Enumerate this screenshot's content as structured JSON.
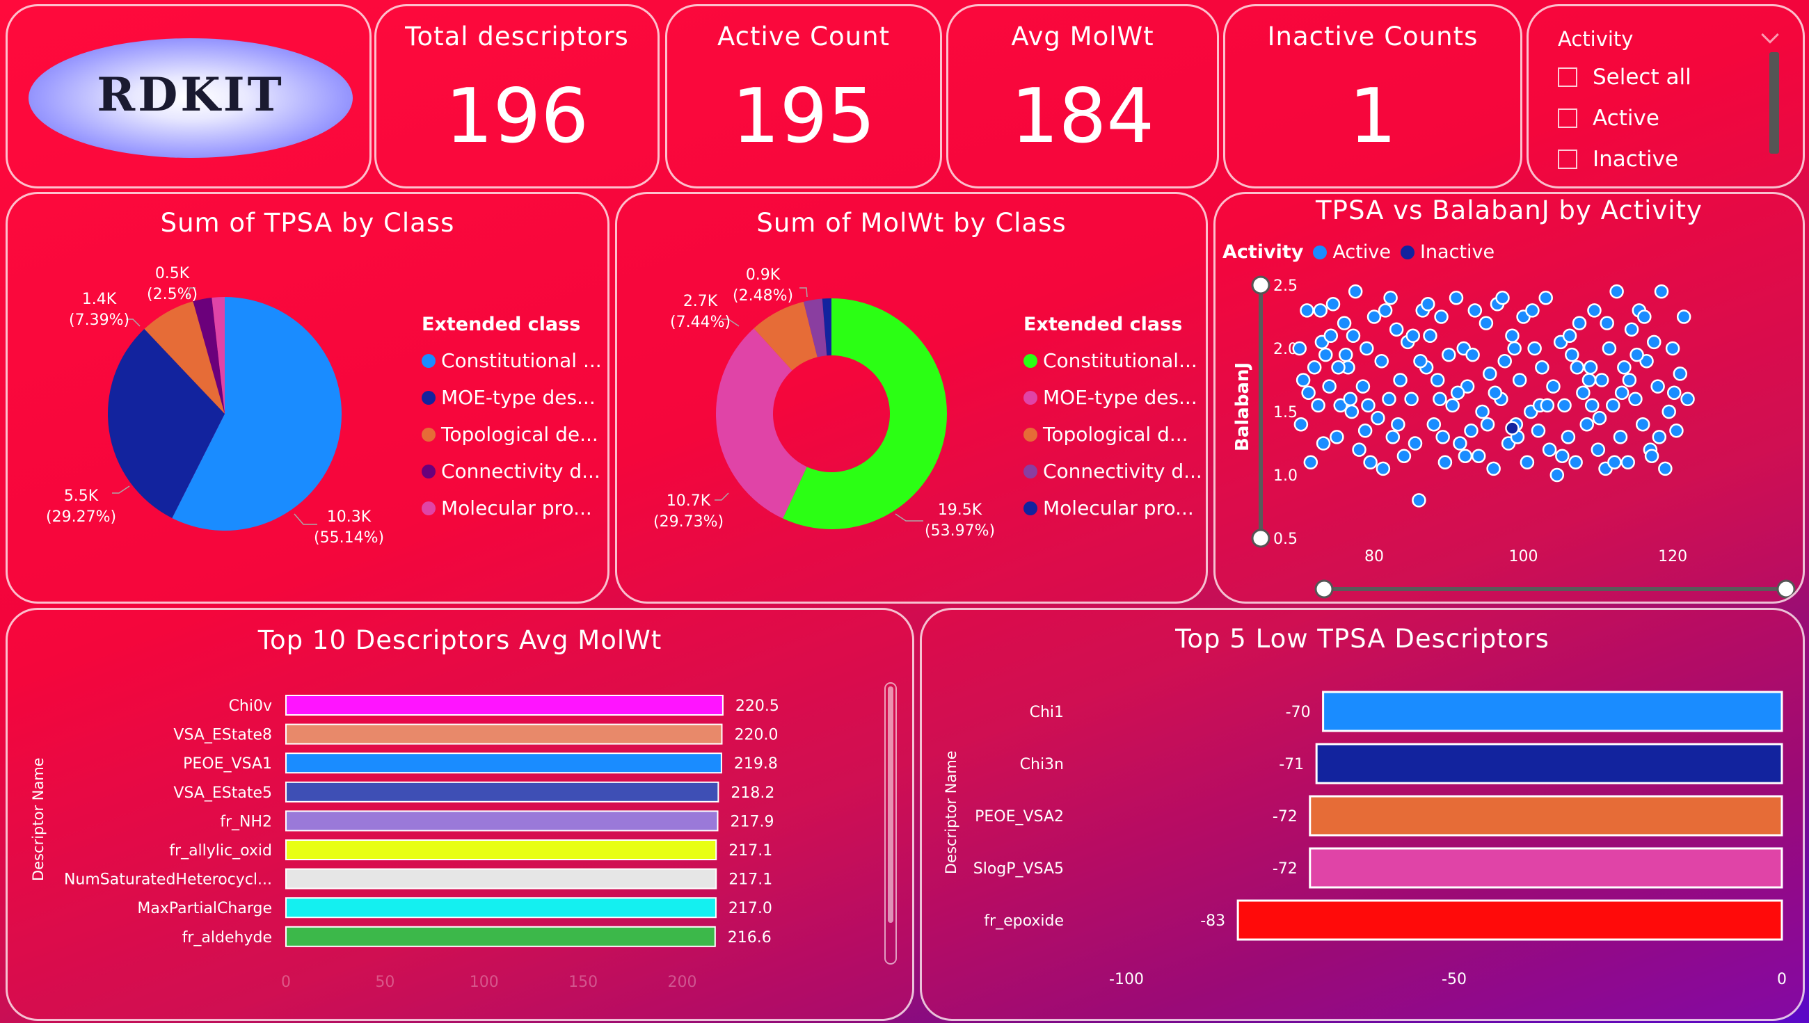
{
  "logo": {
    "text": "RDKIT"
  },
  "kpis": [
    {
      "title": "Total descriptors",
      "value": "196"
    },
    {
      "title": "Active Count",
      "value": "195"
    },
    {
      "title": "Avg MolWt",
      "value": "184"
    },
    {
      "title": "Inactive Counts",
      "value": "1"
    }
  ],
  "slicer": {
    "title": "Activity",
    "options": [
      "Select all",
      "Active",
      "Inactive"
    ]
  },
  "pie_tpsa": {
    "title": "Sum of TPSA by Class",
    "legend_title": "Extended class",
    "legend": [
      "Constitutional ...",
      "MOE-type des...",
      "Topological de...",
      "Connectivity d...",
      "Molecular pro..."
    ],
    "labels": [
      {
        "v": "10.3K",
        "p": "(55.14%)"
      },
      {
        "v": "5.5K",
        "p": "(29.27%)"
      },
      {
        "v": "1.4K",
        "p": "(7.39%)"
      },
      {
        "v": "0.5K",
        "p": "(2.5%)"
      }
    ]
  },
  "donut_molwt": {
    "title": "Sum of MolWt by Class",
    "legend_title": "Extended class",
    "legend": [
      "Constitutional...",
      "MOE-type des...",
      "Topological d...",
      "Connectivity d...",
      "Molecular pro..."
    ],
    "labels": [
      {
        "v": "19.5K",
        "p": "(53.97%)"
      },
      {
        "v": "10.7K",
        "p": "(29.73%)"
      },
      {
        "v": "2.7K",
        "p": "(7.44%)"
      },
      {
        "v": "0.9K",
        "p": "(2.48%)"
      }
    ]
  },
  "scatter": {
    "title": "TPSA vs BalabanJ by Activity",
    "legend_title": "Activity",
    "legend": [
      "Active",
      "Inactive"
    ],
    "ylabel": "BalabanJ",
    "xticks": [
      "80",
      "100",
      "120"
    ],
    "yticks": [
      "2.5",
      "2.0",
      "1.5",
      "1.0",
      "0.5"
    ]
  },
  "top10": {
    "title": "Top 10 Descriptors Avg MolWt",
    "ylabel": "Descriptor Name",
    "xticks": [
      "0",
      "50",
      "100",
      "150",
      "200"
    ]
  },
  "low5": {
    "title": "Top 5 Low TPSA Descriptors",
    "ylabel": "Descriptor Name",
    "xticks": [
      "-100",
      "-50",
      "0"
    ]
  },
  "colors": {
    "constitutional": "#1a8cff",
    "moe": "#12239e",
    "topological": "#e66c37",
    "connectivity": "#6b007b",
    "molecular": "#e044a7",
    "green": "#2bff14"
  },
  "chart_data": [
    {
      "type": "pie",
      "title": "Sum of TPSA by Class",
      "categories": [
        "Constitutional",
        "MOE-type",
        "Topological",
        "Connectivity",
        "Molecular"
      ],
      "values": [
        10.3,
        5.5,
        1.4,
        0.5,
        0.3
      ],
      "percent": [
        55.14,
        29.27,
        7.39,
        2.5,
        1.7
      ],
      "colors": [
        "#1a8cff",
        "#12239e",
        "#e66c37",
        "#6b007b",
        "#e044a7"
      ]
    },
    {
      "type": "pie",
      "title": "Sum of MolWt by Class",
      "categories": [
        "Constitutional",
        "MOE-type",
        "Topological",
        "Connectivity",
        "Molecular"
      ],
      "values": [
        19.5,
        10.7,
        2.7,
        0.9,
        0.4
      ],
      "percent": [
        53.97,
        29.73,
        7.44,
        2.48,
        1.2
      ],
      "colors": [
        "#2bff14",
        "#e044a7",
        "#e66c37",
        "#8a3ea0",
        "#12239e"
      ]
    },
    {
      "type": "scatter",
      "title": "TPSA vs BalabanJ by Activity",
      "ylabel": "BalabanJ",
      "xlim": [
        69,
        124
      ],
      "ylim": [
        0.5,
        2.5
      ],
      "series": [
        {
          "name": "Active",
          "points": [
            [
              70,
              2.0
            ],
            [
              70.5,
              1.75
            ],
            [
              71,
              2.3
            ],
            [
              71.5,
              1.1
            ],
            [
              72,
              1.85
            ],
            [
              72.5,
              1.55
            ],
            [
              73,
              2.05
            ],
            [
              73.5,
              1.95
            ],
            [
              74,
              1.7
            ],
            [
              74.5,
              2.35
            ],
            [
              75,
              1.3
            ],
            [
              75.5,
              1.55
            ],
            [
              76,
              2.2
            ],
            [
              76.5,
              1.85
            ],
            [
              77,
              1.5
            ],
            [
              77.5,
              2.45
            ],
            [
              78,
              1.2
            ],
            [
              78.5,
              1.7
            ],
            [
              79,
              2.0
            ],
            [
              79.5,
              1.1
            ],
            [
              80,
              2.25
            ],
            [
              80.5,
              1.45
            ],
            [
              81,
              1.9
            ],
            [
              81.5,
              2.3
            ],
            [
              82,
              1.6
            ],
            [
              82.5,
              1.3
            ],
            [
              83,
              2.15
            ],
            [
              83.5,
              1.75
            ],
            [
              84,
              1.15
            ],
            [
              84.5,
              2.05
            ],
            [
              85,
              1.6
            ],
            [
              85.5,
              1.25
            ],
            [
              86,
              0.8
            ],
            [
              86.5,
              2.3
            ],
            [
              87,
              1.85
            ],
            [
              87.5,
              2.1
            ],
            [
              88,
              1.4
            ],
            [
              88.5,
              1.75
            ],
            [
              89,
              2.25
            ],
            [
              89.5,
              1.1
            ],
            [
              90,
              1.95
            ],
            [
              90.5,
              1.55
            ],
            [
              91,
              2.4
            ],
            [
              91.5,
              1.25
            ],
            [
              92,
              2.0
            ],
            [
              92.5,
              1.7
            ],
            [
              93,
              1.35
            ],
            [
              93.5,
              2.3
            ],
            [
              94,
              1.15
            ],
            [
              94.5,
              1.5
            ],
            [
              95,
              2.2
            ],
            [
              95.5,
              1.8
            ],
            [
              96,
              1.05
            ],
            [
              96.5,
              2.35
            ],
            [
              97,
              1.6
            ],
            [
              97.5,
              1.9
            ],
            [
              98,
              1.25
            ],
            [
              98.5,
              2.1
            ],
            [
              99,
              1.4
            ],
            [
              99.5,
              1.75
            ],
            [
              100,
              2.25
            ],
            [
              100.5,
              1.1
            ],
            [
              101,
              1.5
            ],
            [
              101.5,
              2.0
            ],
            [
              102,
              1.35
            ],
            [
              102.5,
              1.85
            ],
            [
              103,
              2.4
            ],
            [
              103.5,
              1.2
            ],
            [
              104,
              1.7
            ],
            [
              104.5,
              1.0
            ],
            [
              105,
              2.05
            ],
            [
              105.5,
              1.55
            ],
            [
              106,
              1.3
            ],
            [
              106.5,
              1.95
            ],
            [
              107,
              1.1
            ],
            [
              107.5,
              2.2
            ],
            [
              108,
              1.65
            ],
            [
              108.5,
              1.4
            ],
            [
              109,
              1.85
            ],
            [
              109.5,
              2.3
            ],
            [
              110,
              1.2
            ],
            [
              110.5,
              1.75
            ],
            [
              111,
              1.05
            ],
            [
              111.5,
              2.0
            ],
            [
              112,
              1.55
            ],
            [
              112.5,
              2.45
            ],
            [
              113,
              1.3
            ],
            [
              113.5,
              1.85
            ],
            [
              114,
              1.1
            ],
            [
              114.5,
              2.15
            ],
            [
              115,
              1.6
            ],
            [
              115.5,
              2.3
            ],
            [
              116,
              1.4
            ],
            [
              116.5,
              1.9
            ],
            [
              117,
              1.2
            ],
            [
              117.5,
              2.05
            ],
            [
              118,
              1.7
            ],
            [
              118.5,
              2.45
            ],
            [
              119,
              1.05
            ],
            [
              119.5,
              1.5
            ],
            [
              120,
              2.0
            ],
            [
              120.5,
              1.35
            ],
            [
              121,
              1.8
            ],
            [
              121.5,
              2.25
            ],
            [
              122,
              1.6
            ],
            [
              70.2,
              1.4
            ],
            [
              72.8,
              2.3
            ],
            [
              76.2,
              1.95
            ],
            [
              78.8,
              1.35
            ],
            [
              82.2,
              2.4
            ],
            [
              86.2,
              1.9
            ],
            [
              88.8,
              1.6
            ],
            [
              92.2,
              1.15
            ],
            [
              96.2,
              1.65
            ],
            [
              98.8,
              2.0
            ],
            [
              102.2,
              1.55
            ],
            [
              106.2,
              2.1
            ],
            [
              108.8,
              1.75
            ],
            [
              110.2,
              1.45
            ],
            [
              112.2,
              1.1
            ],
            [
              114.2,
              1.75
            ],
            [
              116.2,
              2.25
            ],
            [
              118.2,
              1.3
            ],
            [
              120.2,
              1.65
            ],
            [
              117.2,
              1.15
            ],
            [
              115.2,
              1.95
            ],
            [
              113.2,
              1.65
            ],
            [
              111.2,
              2.2
            ],
            [
              109.2,
              1.55
            ],
            [
              107.2,
              1.85
            ],
            [
              105.2,
              1.15
            ],
            [
              103.2,
              1.55
            ],
            [
              101.2,
              2.3
            ],
            [
              99.2,
              1.3
            ],
            [
              97.2,
              2.4
            ],
            [
              95.2,
              1.4
            ],
            [
              93.2,
              1.95
            ],
            [
              91.2,
              1.65
            ],
            [
              89.2,
              1.3
            ],
            [
              87.2,
              2.35
            ],
            [
              85.2,
              2.1
            ],
            [
              83.2,
              1.4
            ],
            [
              81.2,
              1.05
            ],
            [
              79.2,
              1.55
            ],
            [
              77.2,
              2.1
            ],
            [
              75.2,
              1.85
            ],
            [
              73.2,
              1.25
            ],
            [
              71.2,
              1.65
            ],
            [
              74.2,
              2.1
            ],
            [
              76.8,
              1.6
            ]
          ]
        },
        {
          "name": "Inactive",
          "points": [
            [
              98.5,
              1.37
            ]
          ]
        }
      ]
    },
    {
      "type": "bar",
      "title": "Top 10 Descriptors Avg MolWt",
      "ylabel": "Descriptor Name",
      "xlim": [
        0,
        220
      ],
      "categories": [
        "Chi0v",
        "VSA_EState8",
        "PEOE_VSA1",
        "VSA_EState5",
        "fr_NH2",
        "fr_allylic_oxid",
        "NumSaturatedHeterocycl...",
        "MaxPartialCharge",
        "fr_aldehyde"
      ],
      "values": [
        220.5,
        220.0,
        219.8,
        218.2,
        217.9,
        217.1,
        217.1,
        217.0,
        216.6
      ],
      "labels": [
        "220.5",
        "220.0",
        "219.8",
        "218.2",
        "217.9",
        "217.1",
        "217.1",
        "217.0",
        "216.6"
      ],
      "colors": [
        "#ff14ff",
        "#e8896a",
        "#1a8cff",
        "#3e4fb5",
        "#9a79d9",
        "#e8ff14",
        "#e6e6e6",
        "#14f0f0",
        "#3cb84a"
      ]
    },
    {
      "type": "bar",
      "title": "Top 5 Low TPSA Descriptors",
      "ylabel": "Descriptor Name",
      "xlim": [
        -100,
        0
      ],
      "categories": [
        "Chi1",
        "Chi3n",
        "PEOE_VSA2",
        "SlogP_VSA5",
        "fr_epoxide"
      ],
      "values": [
        -70,
        -71,
        -72,
        -72,
        -83
      ],
      "labels": [
        "-70",
        "-71",
        "-72",
        "-72",
        "-83"
      ],
      "colors": [
        "#1a8cff",
        "#12239e",
        "#e66c37",
        "#e044a7",
        "#ff0a0a"
      ]
    }
  ]
}
